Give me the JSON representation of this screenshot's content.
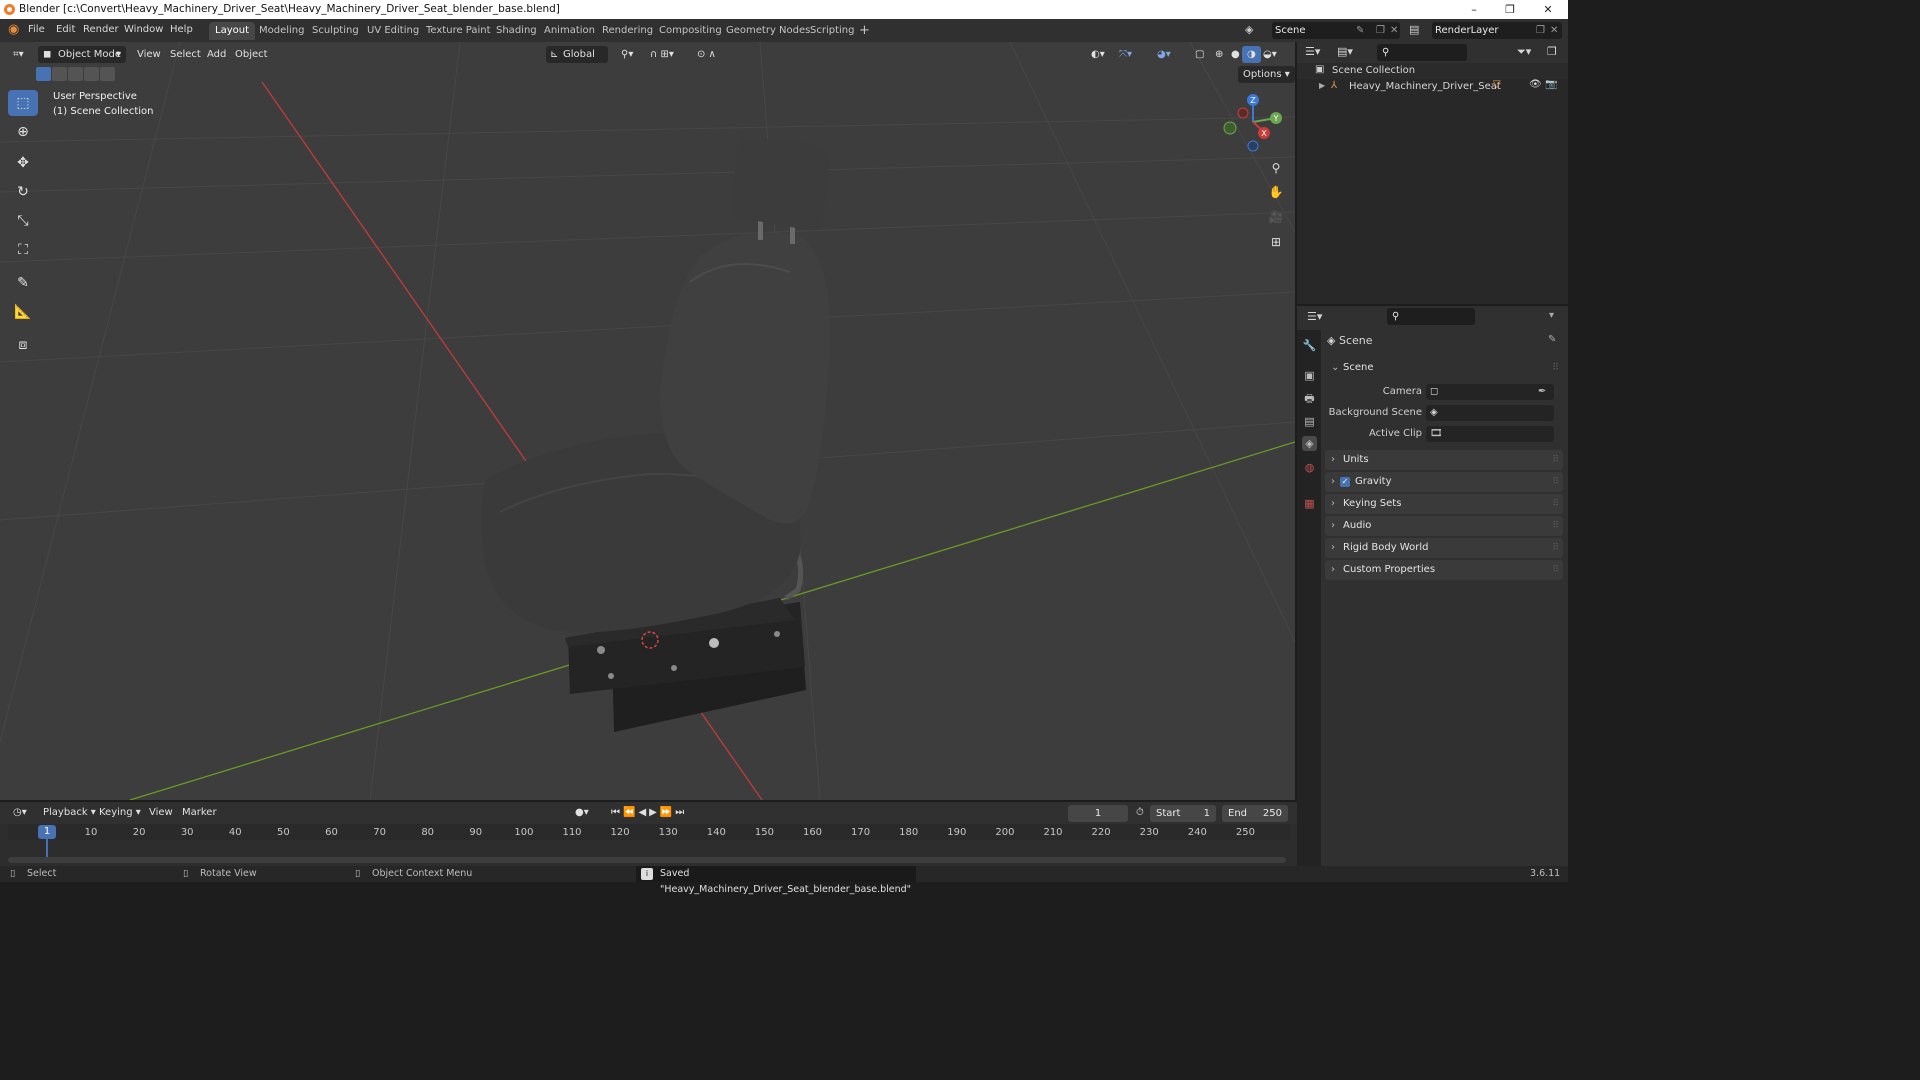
{
  "window": {
    "title": "Blender [c:\\Convert\\Heavy_Machinery_Driver_Seat\\Heavy_Machinery_Driver_Seat_blender_base.blend]",
    "controls": [
      "–",
      "❐",
      "✕"
    ]
  },
  "menubar": {
    "items": [
      "File",
      "Edit",
      "Render",
      "Window",
      "Help"
    ],
    "workspaces": [
      "Layout",
      "Modeling",
      "Sculpting",
      "UV Editing",
      "Texture Paint",
      "Shading",
      "Animation",
      "Rendering",
      "Compositing",
      "Geometry Nodes",
      "Scripting"
    ],
    "active_workspace": "Layout",
    "add_tab": "+",
    "scene_name": "Scene",
    "view_layer": "RenderLayer"
  },
  "viewport": {
    "mode": "Object Mode",
    "menus": [
      "View",
      "Select",
      "Add",
      "Object"
    ],
    "orientation": "Global",
    "options_label": "Options",
    "overlay_text": [
      "User Perspective",
      "(1) Scene Collection"
    ],
    "gizmo_axes": {
      "x": "X",
      "y": "Y",
      "z": "Z"
    },
    "colors": {
      "background": "#3d3d3d",
      "x_axis": "#c23b3b",
      "y_axis": "#6a9a24",
      "grid": "#474747"
    },
    "tools": [
      "select-box-icon",
      "cursor-icon",
      "move-icon",
      "rotate-icon",
      "scale-icon",
      "transform-icon",
      "annotate-icon",
      "measure-icon",
      "add-cube-icon"
    ],
    "nav_icons": [
      "zoom-icon",
      "hand-icon",
      "camera-icon",
      "grid-icon"
    ]
  },
  "outliner": {
    "root": "Scene Collection",
    "items": [
      {
        "label": "Heavy_Machinery_Driver_Seat"
      }
    ]
  },
  "properties": {
    "header": "Scene",
    "section": "Scene",
    "fields": [
      {
        "label": "Camera",
        "value": ""
      },
      {
        "label": "Background Scene",
        "value": ""
      },
      {
        "label": "Active Clip",
        "value": ""
      }
    ],
    "panels": [
      "Units",
      "Gravity",
      "Keying Sets",
      "Audio",
      "Rigid Body World",
      "Custom Properties"
    ],
    "gravity_checked": true
  },
  "timeline": {
    "menus": [
      "Playback",
      "Keying",
      "View",
      "Marker"
    ],
    "current_frame": "1",
    "start_label": "Start",
    "start": "1",
    "end_label": "End",
    "end": "250",
    "ticks": [
      "1",
      "10",
      "20",
      "30",
      "40",
      "50",
      "60",
      "70",
      "80",
      "90",
      "100",
      "110",
      "120",
      "130",
      "140",
      "150",
      "160",
      "170",
      "180",
      "190",
      "200",
      "210",
      "220",
      "230",
      "240",
      "250"
    ]
  },
  "statusbar": {
    "select": "Select",
    "rotate": "Rotate View",
    "context": "Object Context Menu",
    "message": "Saved \"Heavy_Machinery_Driver_Seat_blender_base.blend\"",
    "version": "3.6.11"
  }
}
